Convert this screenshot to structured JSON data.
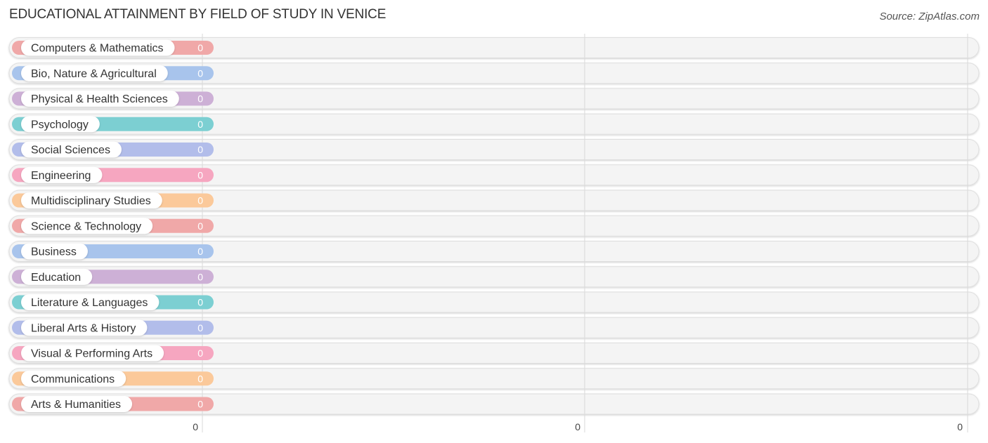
{
  "header": {
    "title": "EDUCATIONAL ATTAINMENT BY FIELD OF STUDY IN VENICE",
    "source": "Source: ZipAtlas.com"
  },
  "chart_data": {
    "type": "bar",
    "orientation": "horizontal",
    "title": "EDUCATIONAL ATTAINMENT BY FIELD OF STUDY IN VENICE",
    "xlabel": "",
    "ylabel": "",
    "categories": [
      "Computers & Mathematics",
      "Bio, Nature & Agricultural",
      "Physical & Health Sciences",
      "Psychology",
      "Social Sciences",
      "Engineering",
      "Multidisciplinary Studies",
      "Science & Technology",
      "Business",
      "Education",
      "Literature & Languages",
      "Liberal Arts & History",
      "Visual & Performing Arts",
      "Communications",
      "Arts & Humanities"
    ],
    "values": [
      0,
      0,
      0,
      0,
      0,
      0,
      0,
      0,
      0,
      0,
      0,
      0,
      0,
      0,
      0
    ],
    "value_labels": [
      "0",
      "0",
      "0",
      "0",
      "0",
      "0",
      "0",
      "0",
      "0",
      "0",
      "0",
      "0",
      "0",
      "0",
      "0"
    ],
    "colors": [
      "#f0a8a8",
      "#a8c4ec",
      "#cdb0d6",
      "#7ccfd2",
      "#b2bdea",
      "#f6a6c0",
      "#fbc99a",
      "#f0a8a8",
      "#a8c4ec",
      "#cdb0d6",
      "#7ccfd2",
      "#b2bdea",
      "#f6a6c0",
      "#fbc99a",
      "#f0a8a8"
    ],
    "x_ticks": [
      "0",
      "0",
      "0"
    ],
    "grid": true,
    "legend": "none"
  }
}
